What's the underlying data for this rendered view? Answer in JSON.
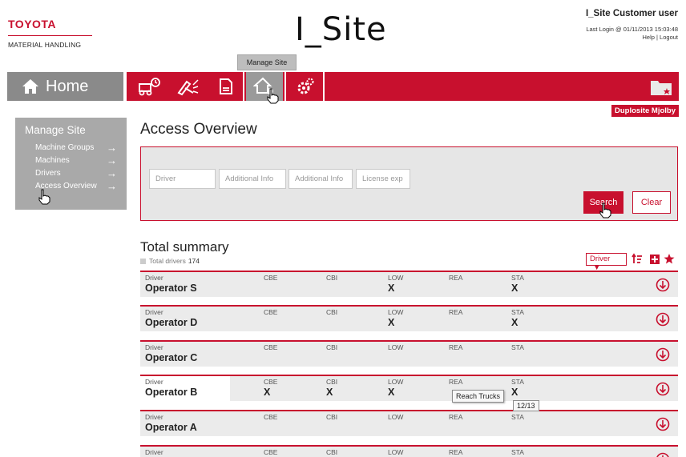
{
  "brand": {
    "line1": "TOYOTA",
    "line2": "MATERIAL HANDLING"
  },
  "app_title": "I_Site",
  "user": {
    "name": "I_Site Customer user",
    "last_login": "Last Login @ 01/11/2013 15:03:48",
    "links": "Help | Logout"
  },
  "nav": {
    "hover_tooltip": "Manage Site",
    "home_label": "Home",
    "icons": [
      "forklift-icon",
      "tools-icon",
      "documents-icon",
      "manage-site-icon",
      "settings-icon"
    ],
    "active_index": 3,
    "folder_icon": "favorites-folder-icon"
  },
  "site_badge": "Duplosite Mjolby",
  "side_menu": {
    "title": "Manage Site",
    "items": [
      {
        "label": "Machine Groups"
      },
      {
        "label": "Machines"
      },
      {
        "label": "Drivers"
      },
      {
        "label": "Access Overview"
      }
    ]
  },
  "main": {
    "title": "Access Overview",
    "filters": [
      {
        "placeholder": "Driver"
      },
      {
        "placeholder": "Additional Info"
      },
      {
        "placeholder": "Additional Info"
      },
      {
        "placeholder": "License exp"
      }
    ],
    "search_label": "Search",
    "clear_label": "Clear"
  },
  "summary": {
    "title": "Total summary",
    "count_label": "Total drivers",
    "count": "174",
    "sort_value": "Driver"
  },
  "table": {
    "columns": [
      "Driver",
      "CBE",
      "CBI",
      "LOW",
      "REA",
      "STA"
    ],
    "rows": [
      {
        "driver": "Operator S",
        "CBE": "",
        "CBI": "",
        "LOW": "X",
        "REA": "",
        "STA": "X"
      },
      {
        "driver": "Operator D",
        "CBE": "",
        "CBI": "",
        "LOW": "X",
        "REA": "",
        "STA": "X"
      },
      {
        "driver": "Operator C",
        "CBE": "",
        "CBI": "",
        "LOW": "",
        "REA": "",
        "STA": ""
      },
      {
        "driver": "Operator B",
        "CBE": "X",
        "CBI": "X",
        "LOW": "X",
        "REA": "",
        "STA": "X"
      },
      {
        "driver": "Operator A",
        "CBE": "",
        "CBI": "",
        "LOW": "",
        "REA": "",
        "STA": ""
      },
      {
        "driver": "",
        "CBE": "",
        "CBI": "",
        "LOW": "",
        "REA": "",
        "STA": ""
      }
    ]
  },
  "tooltips": {
    "reach": "Reach Trucks",
    "count": "12/13"
  },
  "colors": {
    "brand_red": "#c8102e",
    "gray_nav": "#8a8a8a",
    "side_gray": "#a9a9a9"
  }
}
